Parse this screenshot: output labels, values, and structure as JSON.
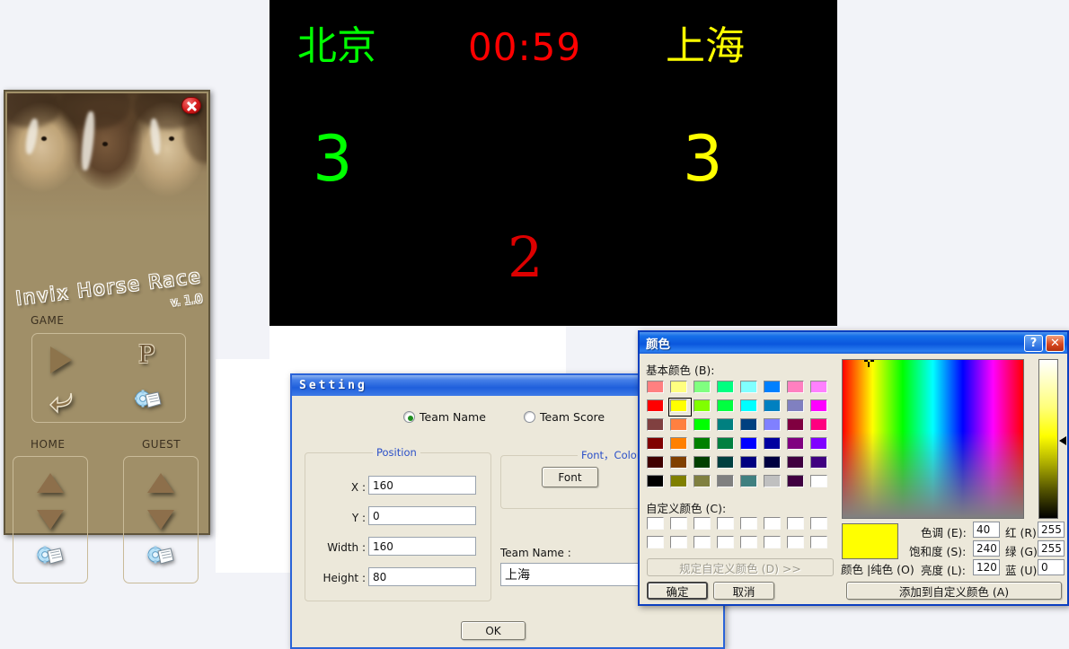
{
  "scoreboard": {
    "home_team": "北京",
    "home_team_color": "#00ff00",
    "timer": "00:59",
    "timer_color": "#ff0000",
    "guest_team": "上海",
    "guest_team_color": "#ffff00",
    "home_score": "3",
    "guest_score": "3",
    "period": "2",
    "period_color": "#dd0000",
    "background_color": "#000000"
  },
  "game_window": {
    "title": "Invix Horse Race",
    "version": "v. 1.0",
    "close_label": "✕",
    "game_section_label": "GAME",
    "home_section_label": "HOME",
    "guest_section_label": "GUEST",
    "play_label": "▶",
    "pause_label": "P",
    "reset_label": "↰",
    "config_label": "settings",
    "up_label": "▲",
    "down_label": "▼"
  },
  "setting_dialog": {
    "title": "Setting",
    "radio_team_name": "Team Name",
    "radio_team_score": "Team Score",
    "radio_selected": "Team Name",
    "position_group_title": "Position",
    "font_color_group_title": "Font，Color",
    "x_label": "X :",
    "x_value": "160",
    "y_label": "Y :",
    "y_value": "0",
    "width_label": "Width :",
    "width_value": "160",
    "height_label": "Height :",
    "height_value": "80",
    "font_button": "Font",
    "team_name_label": "Team Name :",
    "team_name_value": "上海",
    "ok_button": "OK"
  },
  "color_dialog": {
    "title": "颜色",
    "help_label": "?",
    "close_label": "✕",
    "basic_colors_label": "基本颜色 (B):",
    "custom_colors_label": "自定义颜色 (C):",
    "define_custom_button": "规定自定义颜色 (D)  >>",
    "ok_button": "确定",
    "cancel_button": "取消",
    "add_custom_button": "添加到自定义颜色 (A)",
    "color_solid_label": "颜色 |纯色 (O)",
    "hue_label": "色调 (E):",
    "hue_value": "40",
    "sat_label": "饱和度 (S):",
    "sat_value": "240",
    "lum_label": "亮度 (L):",
    "lum_value": "120",
    "red_label": "红 (R):",
    "red_value": "255",
    "green_label": "绿 (G):",
    "green_value": "255",
    "blue_label": "蓝 (U):",
    "blue_value": "0",
    "preview_color": "#ffff00",
    "selected_swatch_index": 9,
    "basic_colors": [
      "#ff8080",
      "#ffff80",
      "#80ff80",
      "#00ff80",
      "#80ffff",
      "#0080ff",
      "#ff80c0",
      "#ff80ff",
      "#ff0000",
      "#ffff00",
      "#80ff00",
      "#00ff40",
      "#00ffff",
      "#0080c0",
      "#8080c0",
      "#ff00ff",
      "#804040",
      "#ff8040",
      "#00ff00",
      "#008080",
      "#004080",
      "#8080ff",
      "#800040",
      "#ff0080",
      "#800000",
      "#ff8000",
      "#008000",
      "#008040",
      "#0000ff",
      "#0000a0",
      "#800080",
      "#8000ff",
      "#400000",
      "#804000",
      "#004000",
      "#004040",
      "#000080",
      "#000040",
      "#400040",
      "#400080",
      "#000000",
      "#808000",
      "#808040",
      "#808080",
      "#408080",
      "#c0c0c0",
      "#400040",
      "#ffffff"
    ],
    "custom_colors": [
      "#ffffff",
      "#ffffff",
      "#ffffff",
      "#ffffff",
      "#ffffff",
      "#ffffff",
      "#ffffff",
      "#ffffff",
      "#ffffff",
      "#ffffff",
      "#ffffff",
      "#ffffff",
      "#ffffff",
      "#ffffff",
      "#ffffff",
      "#ffffff"
    ]
  }
}
